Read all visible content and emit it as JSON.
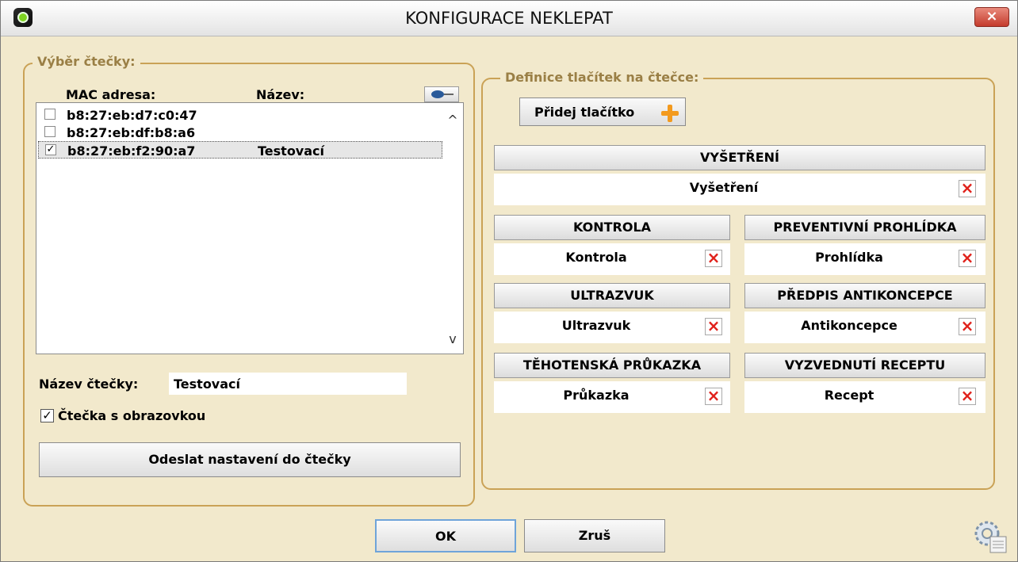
{
  "window": {
    "title": "KONFIGURACE NEKLEPAT",
    "close_label": "×"
  },
  "reader_group": {
    "legend": "Výběr čtečky:",
    "col_mac": "MAC adresa:",
    "col_name": "Název:",
    "items": [
      {
        "mac": "b8:27:eb:d7:c0:47",
        "name": "",
        "checked": false
      },
      {
        "mac": "b8:27:eb:df:b8:a6",
        "name": "",
        "checked": false
      },
      {
        "mac": "b8:27:eb:f2:90:a7",
        "name": "Testovací",
        "checked": true
      }
    ],
    "name_label": "Název čtečky:",
    "name_value": "Testovací",
    "screen_label": "Čtečka s obrazovkou",
    "screen_checked": true,
    "send_button": "Odeslat nastavení do čtečky",
    "scroll_up": "^",
    "scroll_down": "v",
    "check_mark": "✓"
  },
  "buttons_group": {
    "legend": "Definice tlačítek na čtečce:",
    "add_button": "Přidej tlačítko",
    "delete_mark": "×",
    "cards": [
      {
        "header": "VYŠETŘENÍ",
        "value": "Vyšetření"
      },
      {
        "header": "KONTROLA",
        "value": "Kontrola"
      },
      {
        "header": "PREVENTIVNÍ PROHLÍDKA",
        "value": "Prohlídka"
      },
      {
        "header": "ULTRAZVUK",
        "value": "Ultrazvuk"
      },
      {
        "header": "PŘEDPIS ANTIKONCEPCE",
        "value": "Antikoncepce"
      },
      {
        "header": "TĚHOTENSKÁ PRŮKAZKA",
        "value": "Průkazka"
      },
      {
        "header": "VYZVEDNUTÍ RECEPTU",
        "value": "Recept"
      }
    ]
  },
  "footer": {
    "ok": "OK",
    "cancel": "Zruš"
  },
  "colors": {
    "accent": "#caa256",
    "background": "#f2e9cc",
    "delete": "#e0201a",
    "add": "#f39a1e"
  }
}
